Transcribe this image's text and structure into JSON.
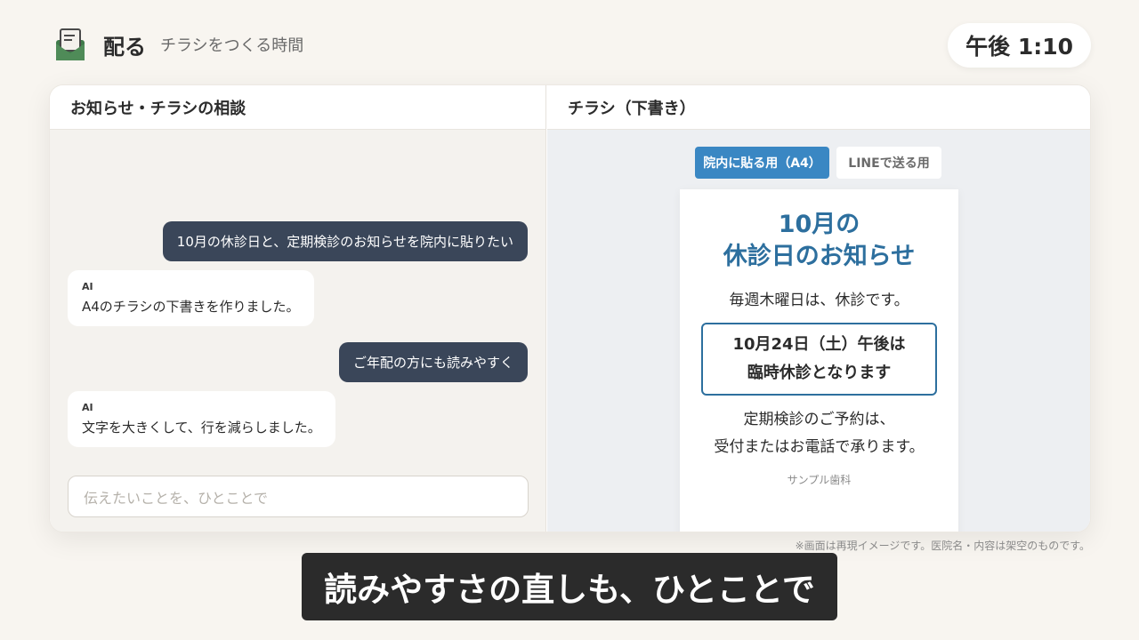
{
  "header": {
    "icon": "envelope-icon",
    "title": "配る",
    "subtitle": "チラシをつくる時間",
    "clock": "午後 1:10"
  },
  "chat_panel": {
    "title": "お知らせ・チラシの相談",
    "messages": [
      {
        "role": "user",
        "text": "10月の休診日と、定期検診のお知らせを院内に貼りたい"
      },
      {
        "role": "ai",
        "tag": "AI",
        "text": "A4のチラシの下書きを作りました。"
      },
      {
        "role": "user",
        "text": "ご年配の方にも読みやすく"
      },
      {
        "role": "ai",
        "tag": "AI",
        "text": "文字を大きくして、行を減らしました。"
      }
    ],
    "input_placeholder": "伝えたいことを、ひとことで"
  },
  "flyer_panel": {
    "title": "チラシ（下書き）",
    "tabs": [
      {
        "label": "院内に貼る用（A4）",
        "active": true
      },
      {
        "label": "LINEで送る用",
        "active": false
      }
    ],
    "flyer": {
      "title_line1": "10月の",
      "title_line2": "休診日のお知らせ",
      "weekly": "毎週木曜日は、休診です。",
      "notice_line1": "10月24日（土）午後は",
      "notice_line2": "臨時休診となります",
      "checkup_line1": "定期検診のご予約は、",
      "checkup_line2": "受付またはお電話で承ります。",
      "clinic": "サンプル歯科"
    }
  },
  "disclaimer": "※画面は再現イメージです。医院名・内容は架空のものです。",
  "caption": "読みやすさの直しも、ひとことで",
  "colors": {
    "background": "#f8f5f0",
    "user_bubble": "#3a4659",
    "accent": "#3a87c3",
    "flyer_title": "#2d6f9e"
  }
}
